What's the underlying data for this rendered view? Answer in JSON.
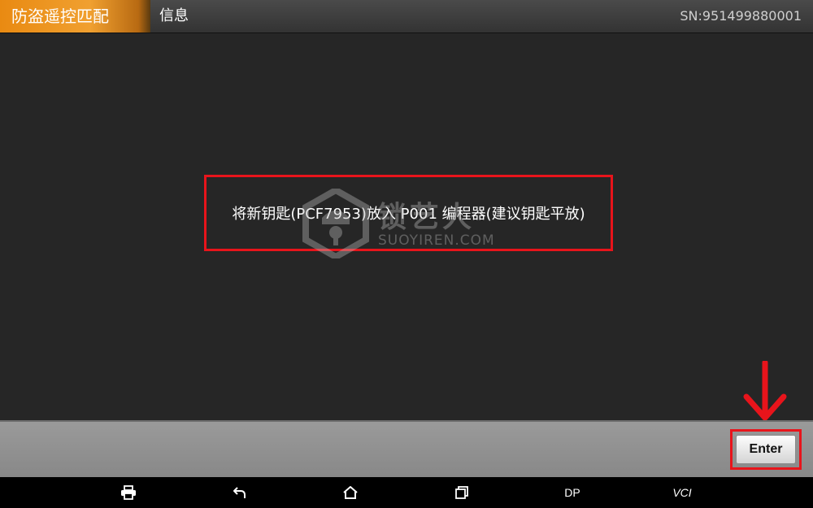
{
  "header": {
    "app_tab": "防盗遥控匹配",
    "title": "信息",
    "serial": "SN:951499880001"
  },
  "main": {
    "message": "将新钥匙(PCF7953)放入 P001 编程器(建议钥匙平放)"
  },
  "watermark": {
    "brand_cn": "锁艺人",
    "brand_en": "SUOYIREN.COM"
  },
  "action_bar": {
    "enter_label": "Enter"
  },
  "nav_bar": {
    "items": [
      {
        "icon": "print-icon"
      },
      {
        "icon": "back-icon"
      },
      {
        "icon": "home-icon"
      },
      {
        "icon": "recent-apps-icon"
      },
      {
        "label": "DP"
      },
      {
        "label": "VCI"
      }
    ]
  },
  "colors": {
    "accent_orange": "#f0a030",
    "highlight_red": "#e8141b",
    "background": "#262626"
  }
}
